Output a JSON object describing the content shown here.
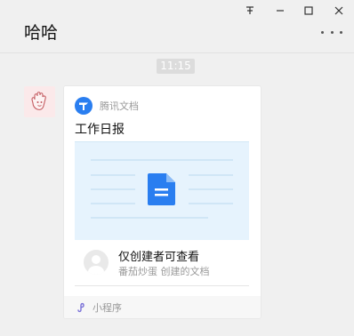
{
  "window": {
    "title": "哈哈",
    "pin_icon_glyph": "⼿",
    "minimize_glyph": "—",
    "maximize_glyph": "☐",
    "close_glyph": "✕"
  },
  "chat": {
    "time": "11:15"
  },
  "card": {
    "source": "腾讯文档",
    "title": "工作日报",
    "permission": "仅创建者可查看",
    "owner_note": "番茄炒蛋 创建的文档",
    "footer": "小程序",
    "accent": "#2a7ef0"
  }
}
